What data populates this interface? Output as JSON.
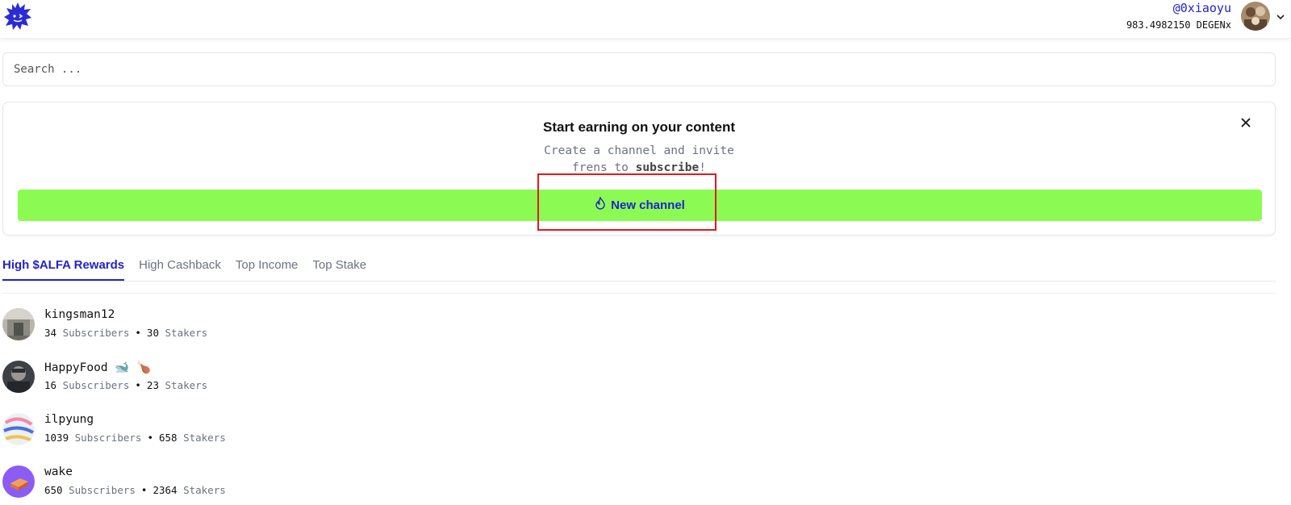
{
  "header": {
    "logo_icon": "spiky-mascot-logo",
    "username": "@0xiaoyu",
    "balance": "983.4982150 DEGENx"
  },
  "search": {
    "placeholder": "Search ..."
  },
  "promo": {
    "title": "Start earning on your content",
    "subtitle_line1": "Create a channel and invite",
    "subtitle_line2_prefix": "frens to ",
    "subtitle_line2_bold": "subscribe",
    "subtitle_line2_suffix": "!",
    "button_label": "New channel",
    "button_icon": "flame-icon",
    "button_color": "#8bfb54",
    "accent_color": "#2222cc"
  },
  "tabs": [
    {
      "label": "High $ALFA Rewards",
      "active": true
    },
    {
      "label": "High Cashback",
      "active": false
    },
    {
      "label": "Top Income",
      "active": false
    },
    {
      "label": "Top Stake",
      "active": false
    }
  ],
  "channels": [
    {
      "name": "kingsman12",
      "subscribers": "34",
      "subscribers_label": "Subscribers",
      "stakers": "30",
      "stakers_label": "Stakers"
    },
    {
      "name": "HappyFood 🐋 🍗",
      "subscribers": "16",
      "subscribers_label": "Subscribers",
      "stakers": "23",
      "stakers_label": "Stakers"
    },
    {
      "name": "ilpyung",
      "subscribers": "1039",
      "subscribers_label": "Subscribers",
      "stakers": "658",
      "stakers_label": "Stakers"
    },
    {
      "name": "wake",
      "subscribers": "650",
      "subscribers_label": "Subscribers",
      "stakers": "2364",
      "stakers_label": "Stakers"
    }
  ]
}
